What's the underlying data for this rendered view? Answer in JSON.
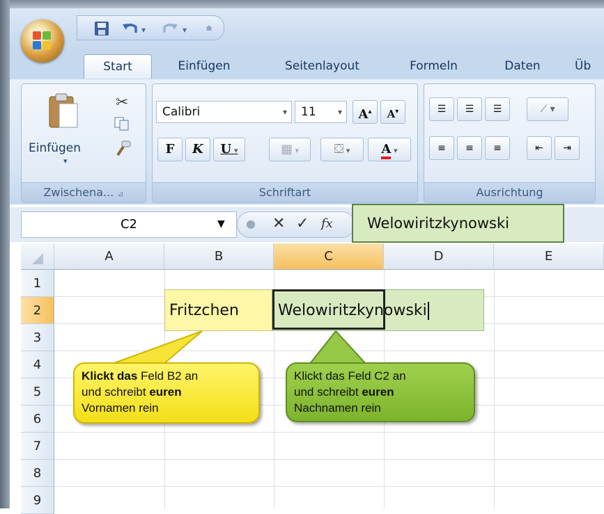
{
  "app": {
    "quick_access": [
      "save-icon",
      "undo-icon",
      "redo-icon",
      "customize-icon"
    ]
  },
  "tabs": [
    "Start",
    "Einfügen",
    "Seitenlayout",
    "Formeln",
    "Daten",
    "Üb"
  ],
  "ribbon": {
    "clipboard": {
      "paste_label": "Einfügen",
      "group_label": "Zwischena..."
    },
    "font": {
      "font_name": "Calibri",
      "font_size": "11",
      "bold": "F",
      "italic": "K",
      "underline": "U",
      "group_label": "Schriftart"
    },
    "alignment": {
      "group_label": "Ausrichtung"
    }
  },
  "formula_bar": {
    "name_box": "C2",
    "fx_label": "fx",
    "value": "Welowiritzkynowski"
  },
  "sheet": {
    "columns": [
      "A",
      "B",
      "C",
      "D",
      "E"
    ],
    "rows": [
      "1",
      "2",
      "3",
      "4",
      "5",
      "6",
      "7",
      "8",
      "9"
    ],
    "cells": {
      "B2": "Fritzchen",
      "C2": "Welowiritzkynowski"
    }
  },
  "callouts": {
    "yellow": {
      "line1_bold": "Klickt das",
      "line1_rest": " Feld B2 an",
      "line2_a": "und schreibt ",
      "line2_bold": "euren",
      "line3": "Vornamen rein"
    },
    "green": {
      "line1": "Klickt das Feld C2 an",
      "line2_a": "und schreibt ",
      "line2_bold": "euren",
      "line3": "Nachnamen rein"
    }
  },
  "colors": {
    "yellow_highlight": "#fff7a8",
    "green_highlight": "#d8ebc0",
    "selected_header": "#f6c05e"
  }
}
